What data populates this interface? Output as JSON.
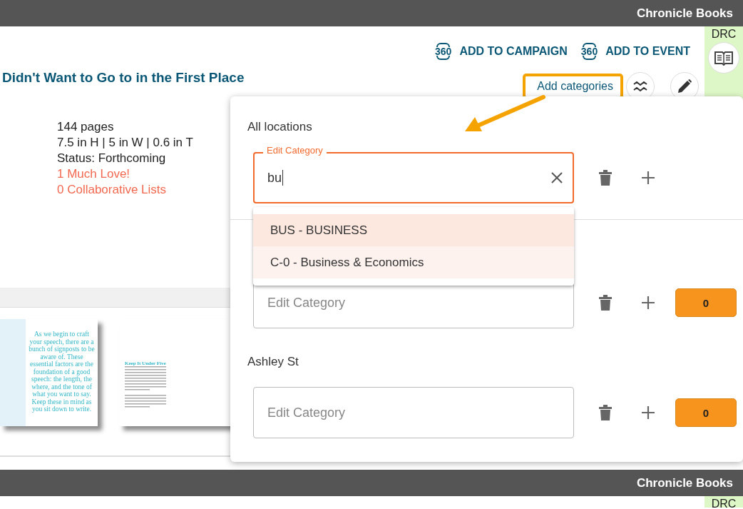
{
  "header_bar": {
    "publisher": "Chronicle Books"
  },
  "side_tab": {
    "label": "DRC"
  },
  "actions": [
    {
      "badge": "360",
      "label": "ADD TO CAMPAIGN"
    },
    {
      "badge": "360",
      "label": "ADD TO EVENT"
    }
  ],
  "book": {
    "title": "Didn't Want to Go to in the First Place",
    "details": [
      "144 pages",
      "7.5 in H | 5 in W | 0.6 in T",
      "Status: Forthcoming"
    ],
    "links": [
      "1 Much Love!",
      "0 Collaborative Lists"
    ]
  },
  "add_categories": {
    "label": "Add categories",
    "highlighted": true
  },
  "preview": {
    "pages": [
      {
        "kind": "quote",
        "text": "As we begin to craft your speech, there are a bunch of signposts to be aware of. These essential factors are the foundation of a good speech: the length, the where, and the tone of what you want to say. Keep these in mind as you sit down to write."
      },
      {
        "kind": "article",
        "heading": "Keep It Under Five"
      }
    ]
  },
  "category_popover": {
    "locations": [
      {
        "name": "All locations",
        "field": {
          "label": "Edit Category",
          "value": "bu",
          "focused": true
        }
      },
      {
        "field": {
          "placeholder": "Edit Category",
          "focused": false
        },
        "count": "0"
      },
      {
        "name": "Ashley St",
        "field": {
          "placeholder": "Edit Category",
          "focused": false
        },
        "count": "0"
      }
    ],
    "suggestions": [
      {
        "label": "BUS - BUSINESS",
        "selected": true
      },
      {
        "label": "C-0 - Business & Economics",
        "selected": false
      }
    ]
  },
  "footer_bar": {
    "publisher": "Chronicle Books"
  },
  "footer_side_tab": {
    "label": "DRC"
  }
}
